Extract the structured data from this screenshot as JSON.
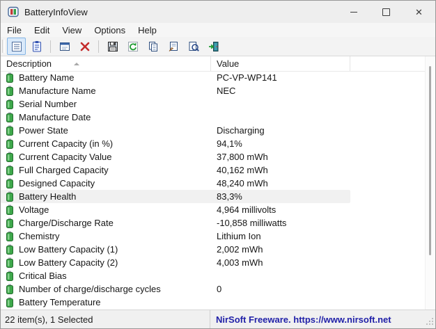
{
  "window": {
    "title": "BatteryInfoView",
    "caption_buttons": [
      "minimize",
      "maximize",
      "close"
    ]
  },
  "menu": {
    "items": [
      "File",
      "Edit",
      "View",
      "Options",
      "Help"
    ]
  },
  "toolbar": {
    "buttons": [
      {
        "icon": "report-view-icon",
        "selected": true,
        "group": 1
      },
      {
        "icon": "clipboard-report-icon",
        "selected": false,
        "group": 1
      },
      {
        "icon": "choose-columns-icon",
        "selected": false,
        "group": 2
      },
      {
        "icon": "delete-icon",
        "selected": false,
        "group": 2
      },
      {
        "icon": "save-icon",
        "selected": false,
        "group": 3
      },
      {
        "icon": "refresh-icon",
        "selected": false,
        "group": 3
      },
      {
        "icon": "copy-icon",
        "selected": false,
        "group": 3
      },
      {
        "icon": "properties-icon",
        "selected": false,
        "group": 3
      },
      {
        "icon": "find-icon",
        "selected": false,
        "group": 3
      },
      {
        "icon": "exit-icon",
        "selected": false,
        "group": 3
      }
    ]
  },
  "table": {
    "columns": [
      {
        "label": "Description",
        "sort": "ascending"
      },
      {
        "label": "Value",
        "sort": null
      }
    ],
    "rows": [
      {
        "description": "Battery Name",
        "value": "PC-VP-WP141",
        "selected": false
      },
      {
        "description": "Manufacture Name",
        "value": "NEC",
        "selected": false
      },
      {
        "description": "Serial Number",
        "value": "",
        "selected": false
      },
      {
        "description": "Manufacture Date",
        "value": "",
        "selected": false
      },
      {
        "description": "Power State",
        "value": "Discharging",
        "selected": false
      },
      {
        "description": "Current Capacity (in %)",
        "value": "94,1%",
        "selected": false
      },
      {
        "description": "Current Capacity Value",
        "value": "37,800 mWh",
        "selected": false
      },
      {
        "description": "Full Charged Capacity",
        "value": "40,162 mWh",
        "selected": false
      },
      {
        "description": "Designed Capacity",
        "value": "48,240 mWh",
        "selected": false
      },
      {
        "description": "Battery Health",
        "value": "83,3%",
        "selected": true
      },
      {
        "description": "Voltage",
        "value": "4,964 millivolts",
        "selected": false
      },
      {
        "description": "Charge/Discharge Rate",
        "value": "-10,858 milliwatts",
        "selected": false
      },
      {
        "description": "Chemistry",
        "value": "Lithium Ion",
        "selected": false
      },
      {
        "description": "Low Battery Capacity (1)",
        "value": "2,002 mWh",
        "selected": false
      },
      {
        "description": "Low Battery Capacity (2)",
        "value": "4,003 mWh",
        "selected": false
      },
      {
        "description": "Critical Bias",
        "value": "",
        "selected": false
      },
      {
        "description": "Number of charge/discharge cycles",
        "value": "0",
        "selected": false
      },
      {
        "description": "Battery Temperature",
        "value": "",
        "selected": false
      }
    ]
  },
  "statusbar": {
    "left": "22 item(s), 1 Selected",
    "right": "NirSoft Freeware. https://www.nirsoft.net"
  },
  "colors": {
    "titlebar_bg": "#eeeeee",
    "toolbar_selected_bg": "#d9e9fa",
    "toolbar_selected_border": "#84b4e4",
    "selected_row_bg": "#f1f1f1",
    "status_link_blue": "#2121a8",
    "battery_green": "#3ea84b",
    "delete_red": "#c42b2b"
  }
}
